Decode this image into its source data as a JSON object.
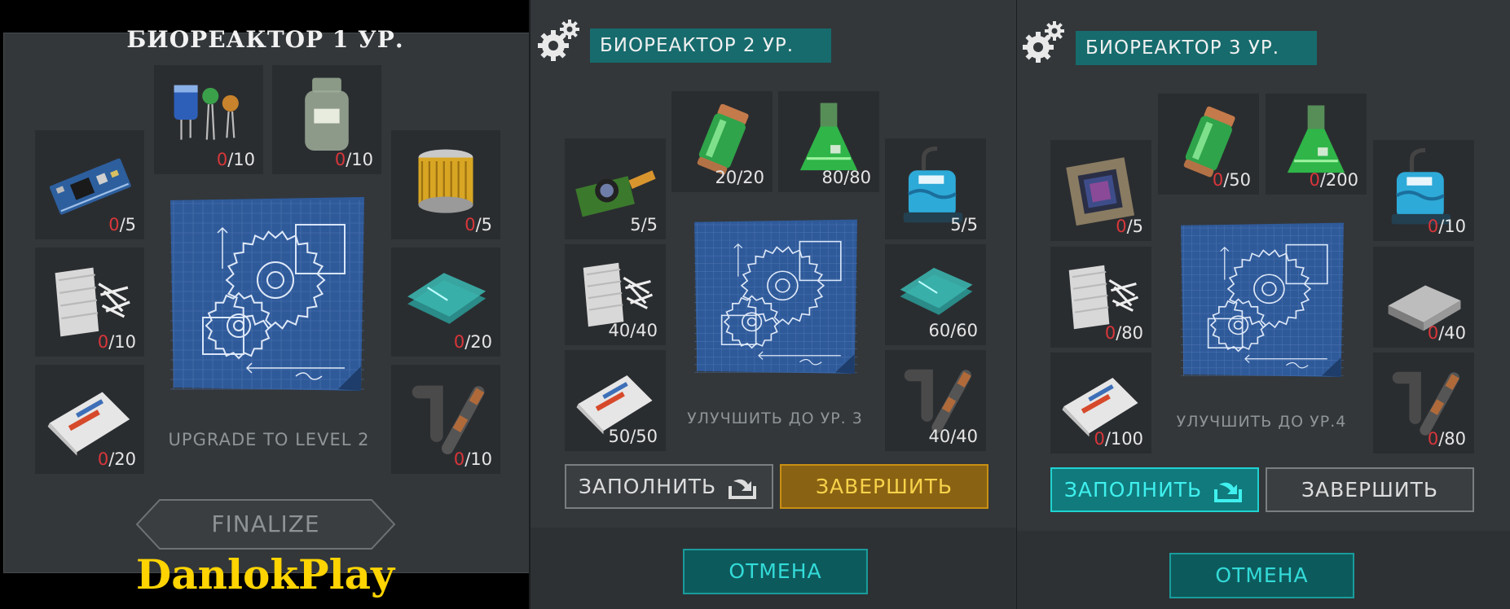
{
  "panel1": {
    "title": "БИОРЕАКТОР 1 УР.",
    "upgrade_text": "UPGRADE TO LEVEL 2",
    "finalize_label": "FINALIZE",
    "watermark": "DanlokPlay",
    "slots": [
      {
        "item": "circuit-board",
        "have": "0",
        "need": "/5"
      },
      {
        "item": "electronic-components",
        "have": "0",
        "need": "/10"
      },
      {
        "item": "chemical-jar",
        "have": "0",
        "need": "/10"
      },
      {
        "item": "filter",
        "have": "0",
        "need": "/5"
      },
      {
        "item": "fiberglass-fabric",
        "have": "0",
        "need": "/10"
      },
      {
        "item": "glass-sheets",
        "have": "0",
        "need": "/20"
      },
      {
        "item": "cement-bag",
        "have": "0",
        "need": "/20"
      },
      {
        "item": "pipes",
        "have": "0",
        "need": "/10"
      }
    ]
  },
  "panel2": {
    "title": "БИОРЕАКТОР 2 УР.",
    "upgrade_text": "УЛУЧШИТЬ ДО УР. 3",
    "fill_label": "ЗАПОЛНИТЬ",
    "finish_label": "ЗАВЕРШИТЬ",
    "cancel_label": "ОТМЕНА",
    "slots": [
      {
        "item": "camera-module",
        "have": "5",
        "need": "/5"
      },
      {
        "item": "green-battery",
        "have": "20",
        "need": "/20"
      },
      {
        "item": "chemical-flask",
        "have": "80",
        "need": "/80"
      },
      {
        "item": "water-pump",
        "have": "5",
        "need": "/5"
      },
      {
        "item": "fiberglass-fabric",
        "have": "40",
        "need": "/40"
      },
      {
        "item": "glass-sheets",
        "have": "60",
        "need": "/60"
      },
      {
        "item": "cement-bag",
        "have": "50",
        "need": "/50"
      },
      {
        "item": "pipes",
        "have": "40",
        "need": "/40"
      }
    ]
  },
  "panel3": {
    "title": "БИОРЕАКТОР 3 УР.",
    "upgrade_text": "УЛУЧШИТЬ ДО УР.4",
    "fill_label": "ЗАПОЛНИТЬ",
    "finish_label": "ЗАВЕРШИТЬ",
    "cancel_label": "ОТМЕНА",
    "slots": [
      {
        "item": "processor-chip",
        "have": "0",
        "need": "/5"
      },
      {
        "item": "green-battery",
        "have": "0",
        "need": "/50"
      },
      {
        "item": "chemical-flask",
        "have": "0",
        "need": "/200"
      },
      {
        "item": "water-pump",
        "have": "0",
        "need": "/10"
      },
      {
        "item": "fiberglass-fabric",
        "have": "0",
        "need": "/80"
      },
      {
        "item": "steel-ingot",
        "have": "0",
        "need": "/40"
      },
      {
        "item": "cement-bag",
        "have": "0",
        "need": "/100"
      },
      {
        "item": "pipes",
        "have": "0",
        "need": "/80"
      }
    ]
  },
  "colors": {
    "missing_red": "#d9363a",
    "teal_header": "#176b6d",
    "gold_button": "#c88f12",
    "teal_button": "#1fd2d0",
    "watermark_yellow": "#ffd400"
  }
}
